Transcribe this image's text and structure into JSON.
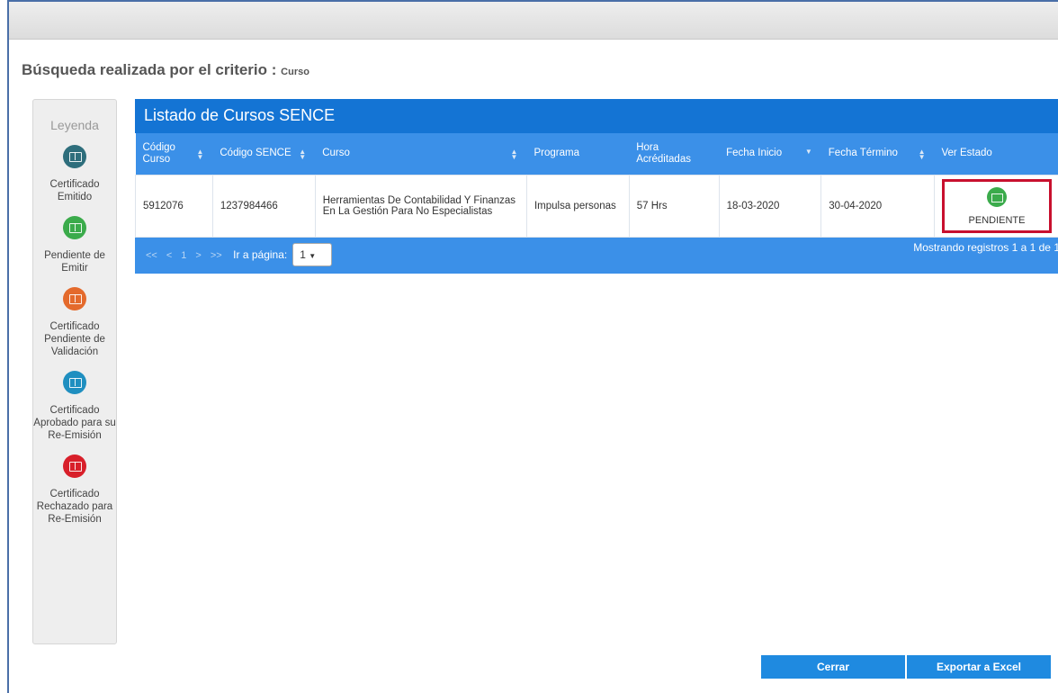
{
  "search": {
    "prefix": "Búsqueda realizada por el criterio :",
    "criterion": "Curso"
  },
  "legend": {
    "title": "Leyenda",
    "items": [
      {
        "label": "Certificado Emitido",
        "color": "#2e6e7c"
      },
      {
        "label": "Pendiente de Emitir",
        "color": "#3bab4b"
      },
      {
        "label": "Certificado Pendiente de Validación",
        "color": "#e46a2c"
      },
      {
        "label": "Certificado Aprobado para su Re-Emisión",
        "color": "#1f8fc0"
      },
      {
        "label": "Certificado Rechazado para Re-Emisión",
        "color": "#d81f2a"
      }
    ]
  },
  "table": {
    "title": "Listado de Cursos SENCE",
    "columns": [
      "Código Curso",
      "Código SENCE",
      "Curso",
      "Programa",
      "Hora Acréditadas",
      "Fecha Inicio",
      "Fecha Término",
      "Ver Estado"
    ],
    "rows": [
      {
        "codigo_curso": "5912076",
        "codigo_sence": "1237984466",
        "curso": "Herramientas De Contabilidad Y Finanzas En La Gestión Para No Especialistas",
        "programa": "Impulsa personas",
        "horas": "57 Hrs",
        "fecha_inicio": "18-03-2020",
        "fecha_termino": "30-04-2020",
        "estado": "PENDIENTE"
      }
    ]
  },
  "pager": {
    "first": "<<",
    "prev": "<",
    "page": "1",
    "next": ">",
    "last": ">>",
    "goto_label": "Ir a página:",
    "selected_page": "1",
    "records": "Mostrando registros 1 a 1 de 1"
  },
  "buttons": {
    "close": "Cerrar",
    "export": "Exportar a Excel"
  }
}
